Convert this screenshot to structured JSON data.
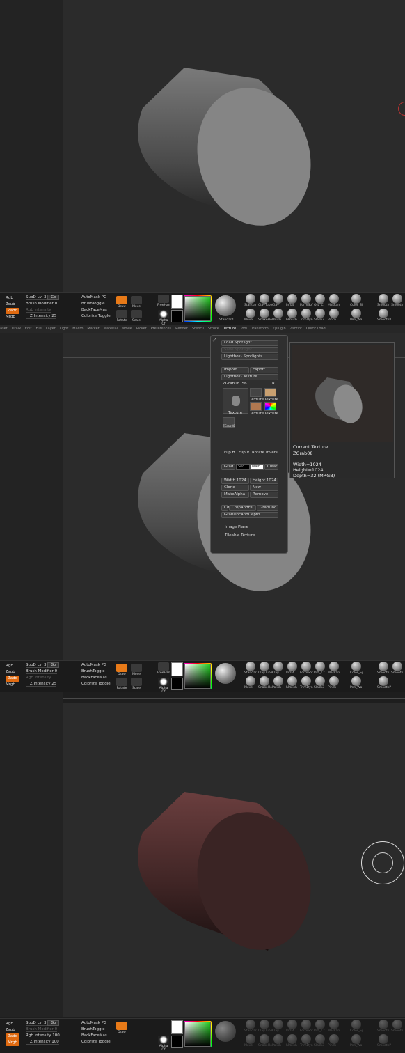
{
  "toolbar": {
    "rgb": "Rgb",
    "zsub": "Zsub",
    "zadd": "Zadd",
    "mrgb": "Mrgb",
    "subd_lvl": "SubD Lvl 3",
    "go": "Go",
    "brush_modifier": "Brush Modifier 0",
    "rgb_intensity": "Rgb Intensity",
    "rgb_intensity_100": "Rgb Intensity 100",
    "z_intensity": "Z Intensity 25",
    "z_intensity_100": "Z Intensity 100",
    "automask": "AutoMask PG",
    "brush_toggle": "BrushToggle",
    "backface": "BackFaceMas",
    "colorize": "Colorize Toggle",
    "draw": "Draw",
    "move": "Move",
    "scale": "Scale",
    "rotate": "Rotate",
    "freehand": "FreeHan",
    "alpha": "Alpha Of",
    "standard": "Standard",
    "brushes_row1": [
      "Standar",
      "ClayTube",
      "Clay",
      "Inflat",
      "FormSof",
      "Orb_Cr",
      "Maskan"
    ],
    "brushes_row2": [
      "Move",
      "SnakeHo",
      "Polish",
      "hPolish",
      "TrimDyn",
      "Slash3",
      "Pinch"
    ],
    "right_brushes": [
      "Color_Sj",
      "Smooth",
      "Smooth",
      "Pen_Wa",
      "SmoothP"
    ]
  },
  "menubar": [
    "aset",
    "Draw",
    "Edit",
    "File",
    "Layer",
    "Light",
    "Macro",
    "Marker",
    "Material",
    "Movie",
    "Picker",
    "Preferences",
    "Render",
    "Stencil",
    "Stroke",
    "Texture",
    "Tool",
    "Transform",
    "Zplugin",
    "Zscript",
    "Quick Load"
  ],
  "menubar_active": "Texture",
  "texture_panel": {
    "load_spotlight": "Load Spotlight",
    "save_spotlight": "Save Spotlight",
    "lightbox_spotlights": "Lightbox› Spotlights",
    "import": "Import",
    "export": "Export",
    "lightbox_texture": "Lightbox› Texture",
    "current_name": "ZGrab08. 56",
    "r_label": "R",
    "thumb_labels": [
      "Texture",
      "Texture",
      "Texture",
      "Texture",
      "Texture"
    ],
    "zgrab_small": "ZGrab08",
    "action_labels": [
      "Flip H",
      "Flip V",
      "Rotate",
      "Invers"
    ],
    "grad": "Grad",
    "sec": "Sec",
    "main": "Main",
    "clear": "Clear",
    "width": "Width 1024",
    "height": "Height 1024",
    "clone": "Clone",
    "new": "New",
    "make_alpha": "MakeAlpha",
    "remove": "Remove",
    "cd": "Cd",
    "crop_and_fill": "CropAndFill",
    "grab_doc": "GrabDoc",
    "grab_doc_depth": "GrabDocAndDepth",
    "image_plane": "Image Plane",
    "tileable_texture": "Tileable Texture"
  },
  "preview": {
    "title": "Current Texture",
    "name": "ZGrab08",
    "width": "Width=1024",
    "height": "Height=1024",
    "depth": "Depth=32 (MRGB)"
  },
  "colors": {
    "accent": "#e06a10",
    "gray_cylinder": "#8a8a8a",
    "red_cylinder": "#5a3434"
  }
}
